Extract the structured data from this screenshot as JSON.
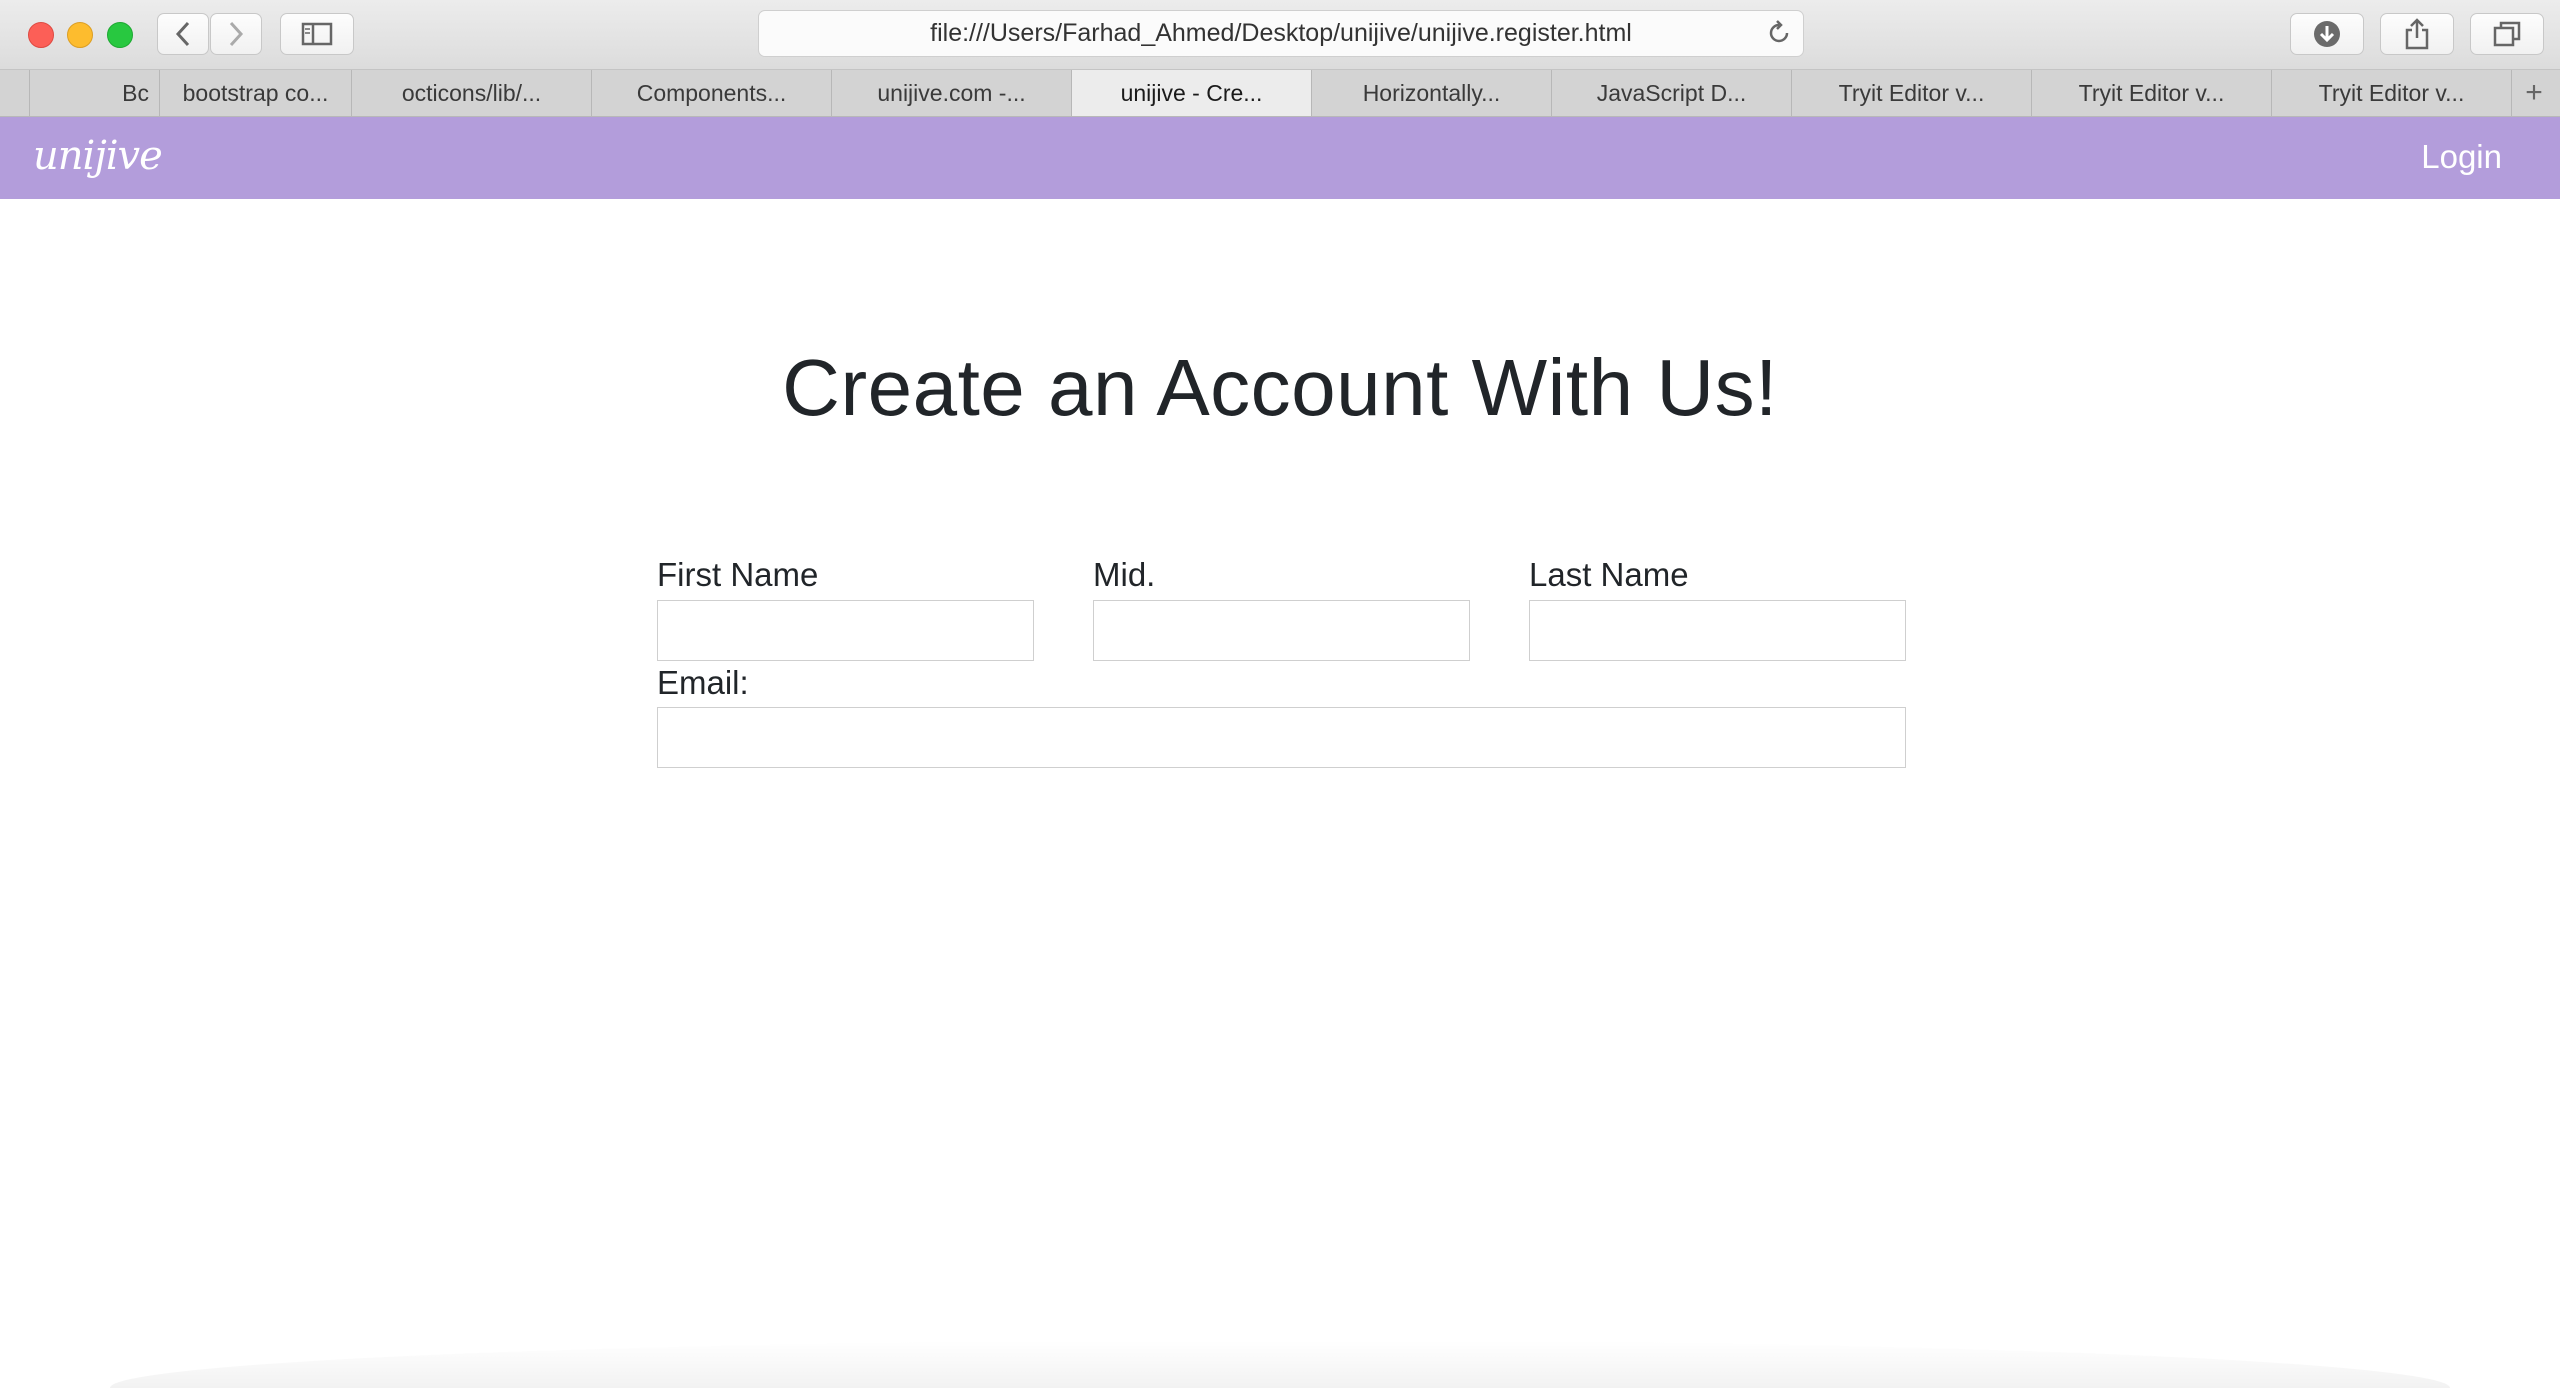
{
  "browser": {
    "url": "file:///Users/Farhad_Ahmed/Desktop/unijive/unijive.register.html",
    "tabs": [
      {
        "label": "",
        "active": false
      },
      {
        "label": "Bc",
        "active": false
      },
      {
        "label": "bootstrap co...",
        "active": false
      },
      {
        "label": "octicons/lib/...",
        "active": false
      },
      {
        "label": "Components...",
        "active": false
      },
      {
        "label": "unijive.com -...",
        "active": false
      },
      {
        "label": "unijive - Cre...",
        "active": true
      },
      {
        "label": "Horizontally...",
        "active": false
      },
      {
        "label": "JavaScript D...",
        "active": false
      },
      {
        "label": "Tryit Editor v...",
        "active": false
      },
      {
        "label": "Tryit Editor v...",
        "active": false
      },
      {
        "label": "Tryit Editor v...",
        "active": false
      }
    ],
    "new_tab_label": "+"
  },
  "navbar": {
    "brand": "unijive",
    "login_label": "Login",
    "color": "#b39ddb"
  },
  "main": {
    "title": "Create an Account With Us!",
    "form": {
      "first_name_label": "First Name",
      "first_name_value": "",
      "mid_label": "Mid.",
      "mid_value": "",
      "last_name_label": "Last Name",
      "last_name_value": "",
      "email_label": "Email:",
      "email_value": ""
    }
  }
}
